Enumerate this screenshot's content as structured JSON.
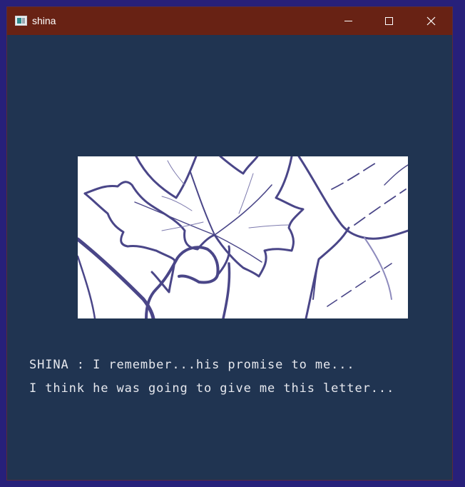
{
  "window": {
    "title": "shina",
    "icon": "app-window-icon",
    "controls": [
      "minimize-icon",
      "maximize-icon",
      "close-icon"
    ],
    "colors": {
      "titlebar": "#682214",
      "client_background": "#203451",
      "desktop": "#27207a",
      "dialogue_text": "#e6e8ee",
      "line_art": "#4a4688"
    }
  },
  "scene": {
    "illustration": "maple-leaf-sketch"
  },
  "dialogue": {
    "line1": "SHINA : I remember...his promise to me...",
    "line2": "I think he was going to give me this letter..."
  }
}
